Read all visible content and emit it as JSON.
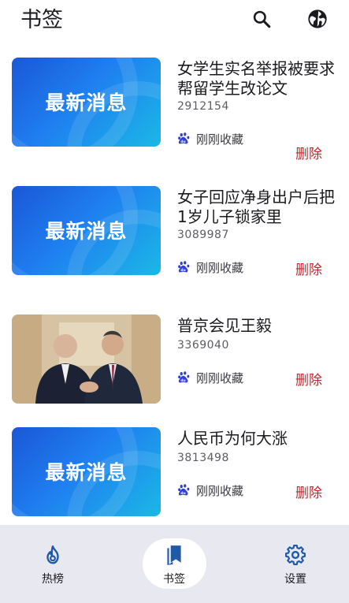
{
  "header": {
    "title": "书签",
    "search_icon": "search-icon",
    "globe_icon": "globe-icon"
  },
  "colors": {
    "accent": "#1a57d6",
    "delete": "#c0262d",
    "nav_bg": "#e8e8f0"
  },
  "bookmarks": [
    {
      "title": "女学生实名举报被要求帮留学生改论文",
      "id_number": "2912154",
      "source_label": "刚刚收藏",
      "delete_label": "删除",
      "thumb_text": "最新消息",
      "thumb_kind": "news"
    },
    {
      "title": "女子回应净身出户后把1岁儿子锁家里",
      "id_number": "3089987",
      "source_label": "刚刚收藏",
      "delete_label": "删除",
      "thumb_text": "最新消息",
      "thumb_kind": "news"
    },
    {
      "title": "普京会见王毅",
      "id_number": "3369040",
      "source_label": "刚刚收藏",
      "delete_label": "删除",
      "thumb_text": "",
      "thumb_kind": "photo"
    },
    {
      "title": "人民币为何大涨",
      "id_number": "3813498",
      "source_label": "刚刚收藏",
      "delete_label": "删除",
      "thumb_text": "最新消息",
      "thumb_kind": "news"
    }
  ],
  "bottom_nav": {
    "items": [
      {
        "label": "热榜",
        "icon": "fire-icon",
        "selected": false
      },
      {
        "label": "书签",
        "icon": "bookmark-icon",
        "selected": true
      },
      {
        "label": "设置",
        "icon": "gear-icon",
        "selected": false
      }
    ]
  }
}
